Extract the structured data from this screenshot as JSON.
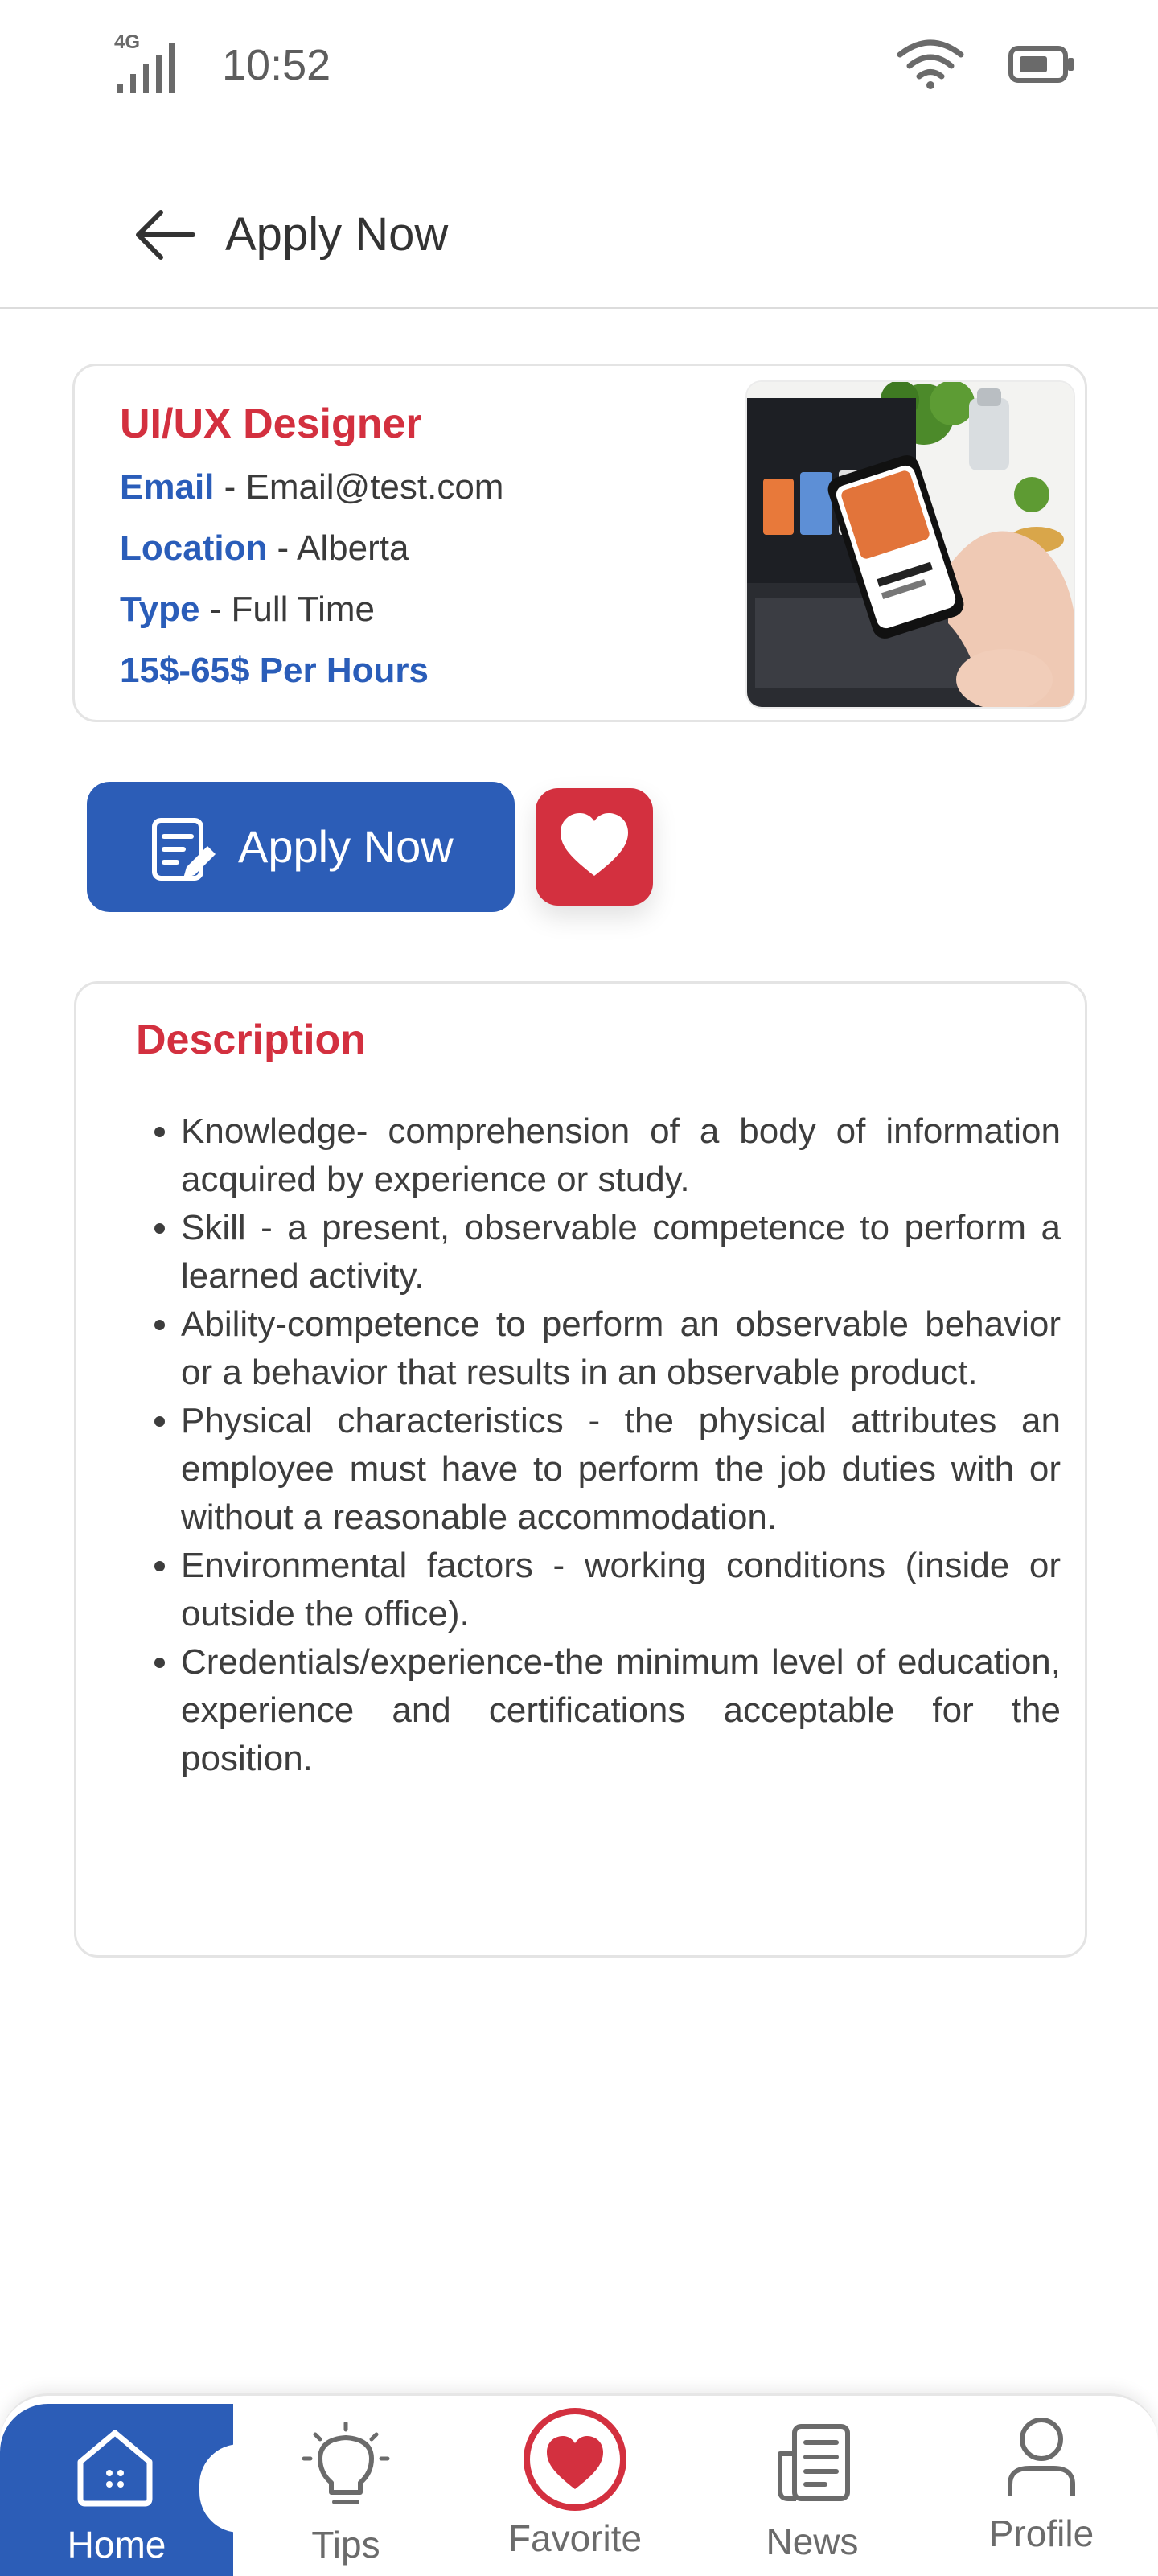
{
  "status_bar": {
    "network": "4G",
    "time": "10:52"
  },
  "header": {
    "title": "Apply Now"
  },
  "job": {
    "title": "UI/UX Designer",
    "email_label": "Email",
    "email_value": "Email@test.com",
    "location_label": "Location",
    "location_value": "Alberta",
    "type_label": "Type",
    "type_value": "Full Time",
    "rate": "15$-65$ Per Hours",
    "separator": " - "
  },
  "actions": {
    "apply_label": "Apply Now"
  },
  "description": {
    "title": "Description",
    "items": [
      "Knowledge- comprehension of a body of information acquired by experience or study.",
      "Skill - a present, observable competence to perform a learned activity.",
      "Ability-competence to perform an observable behavior or a behavior that results in an observable product.",
      "Physical characteristics - the physical attributes an employee must have to perform the job duties with or without a reasonable accommodation.",
      "Environmental factors - working conditions (inside or outside the office).",
      "Credentials/experience-the minimum level of education, experience and certifications acceptable for the position."
    ]
  },
  "nav": {
    "items": [
      {
        "label": "Home",
        "icon": "home-icon",
        "active": true
      },
      {
        "label": "Tips",
        "icon": "lightbulb-icon"
      },
      {
        "label": "Favorite",
        "icon": "heart-icon"
      },
      {
        "label": "News",
        "icon": "news-icon"
      },
      {
        "label": "Profile",
        "icon": "profile-icon"
      }
    ]
  },
  "colors": {
    "primary": "#2c5db7",
    "accent": "#d3303f"
  }
}
